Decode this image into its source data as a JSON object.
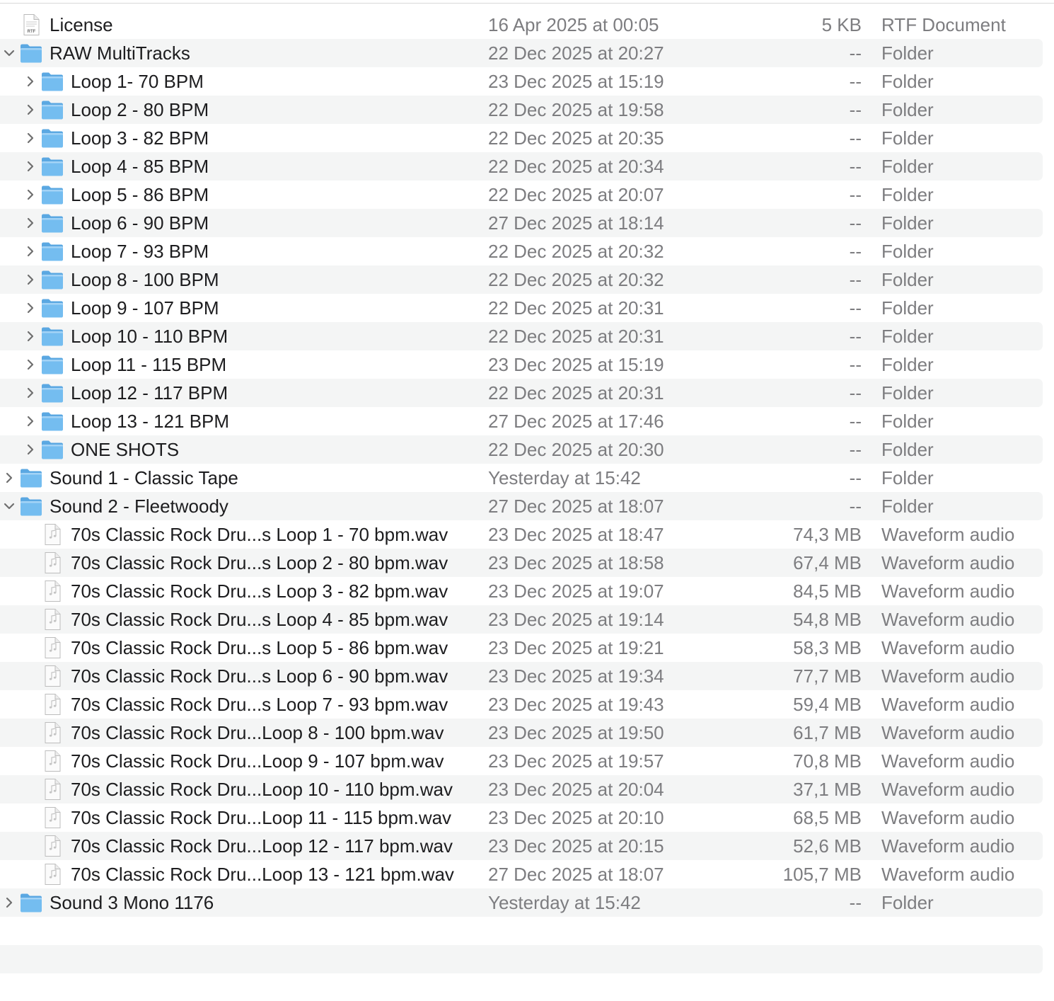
{
  "rows": [
    {
      "name": "License",
      "date": "16 Apr 2025 at 00:05",
      "size": "5 KB",
      "kind": "RTF Document",
      "level": 0,
      "icon": "rtf-document-icon",
      "icon_label": "RTF",
      "disclosure": "none"
    },
    {
      "name": "RAW MultiTracks",
      "date": "22 Dec 2025 at 20:27",
      "size": "--",
      "kind": "Folder",
      "level": 0,
      "icon": "folder-icon",
      "disclosure": "expanded"
    },
    {
      "name": "Loop 1- 70 BPM",
      "date": "23 Dec 2025 at 15:19",
      "size": "--",
      "kind": "Folder",
      "level": 1,
      "icon": "folder-icon",
      "disclosure": "collapsed"
    },
    {
      "name": "Loop 2 - 80 BPM",
      "date": "22 Dec 2025 at 19:58",
      "size": "--",
      "kind": "Folder",
      "level": 1,
      "icon": "folder-icon",
      "disclosure": "collapsed"
    },
    {
      "name": "Loop 3 - 82 BPM",
      "date": "22 Dec 2025 at 20:35",
      "size": "--",
      "kind": "Folder",
      "level": 1,
      "icon": "folder-icon",
      "disclosure": "collapsed"
    },
    {
      "name": "Loop 4 - 85 BPM",
      "date": "22 Dec 2025 at 20:34",
      "size": "--",
      "kind": "Folder",
      "level": 1,
      "icon": "folder-icon",
      "disclosure": "collapsed"
    },
    {
      "name": "Loop 5 - 86 BPM",
      "date": "22 Dec 2025 at 20:07",
      "size": "--",
      "kind": "Folder",
      "level": 1,
      "icon": "folder-icon",
      "disclosure": "collapsed"
    },
    {
      "name": "Loop 6 - 90 BPM",
      "date": "27 Dec 2025 at 18:14",
      "size": "--",
      "kind": "Folder",
      "level": 1,
      "icon": "folder-icon",
      "disclosure": "collapsed"
    },
    {
      "name": "Loop 7 - 93 BPM",
      "date": "22 Dec 2025 at 20:32",
      "size": "--",
      "kind": "Folder",
      "level": 1,
      "icon": "folder-icon",
      "disclosure": "collapsed"
    },
    {
      "name": "Loop 8 - 100 BPM",
      "date": "22 Dec 2025 at 20:32",
      "size": "--",
      "kind": "Folder",
      "level": 1,
      "icon": "folder-icon",
      "disclosure": "collapsed"
    },
    {
      "name": "Loop 9 - 107 BPM",
      "date": "22 Dec 2025 at 20:31",
      "size": "--",
      "kind": "Folder",
      "level": 1,
      "icon": "folder-icon",
      "disclosure": "collapsed"
    },
    {
      "name": "Loop 10 - 110 BPM",
      "date": "22 Dec 2025 at 20:31",
      "size": "--",
      "kind": "Folder",
      "level": 1,
      "icon": "folder-icon",
      "disclosure": "collapsed"
    },
    {
      "name": "Loop 11 - 115 BPM",
      "date": "23 Dec 2025 at 15:19",
      "size": "--",
      "kind": "Folder",
      "level": 1,
      "icon": "folder-icon",
      "disclosure": "collapsed"
    },
    {
      "name": "Loop 12 - 117 BPM",
      "date": "22 Dec 2025 at 20:31",
      "size": "--",
      "kind": "Folder",
      "level": 1,
      "icon": "folder-icon",
      "disclosure": "collapsed"
    },
    {
      "name": "Loop 13 - 121 BPM",
      "date": "27 Dec 2025 at 17:46",
      "size": "--",
      "kind": "Folder",
      "level": 1,
      "icon": "folder-icon",
      "disclosure": "collapsed"
    },
    {
      "name": "ONE SHOTS",
      "date": "22 Dec 2025 at 20:30",
      "size": "--",
      "kind": "Folder",
      "level": 1,
      "icon": "folder-icon",
      "disclosure": "collapsed"
    },
    {
      "name": "Sound 1 - Classic Tape",
      "date": "Yesterday at 15:42",
      "size": "--",
      "kind": "Folder",
      "level": 0,
      "icon": "folder-icon",
      "disclosure": "collapsed"
    },
    {
      "name": "Sound 2 - Fleetwoody",
      "date": "27 Dec 2025 at 18:07",
      "size": "--",
      "kind": "Folder",
      "level": 0,
      "icon": "folder-icon",
      "disclosure": "expanded"
    },
    {
      "name": "70s Classic Rock Dru...s Loop 1 - 70 bpm.wav",
      "date": "23 Dec 2025 at 18:47",
      "size": "74,3 MB",
      "kind": "Waveform audio",
      "level": 1,
      "icon": "audio-file-icon",
      "disclosure": "none"
    },
    {
      "name": "70s Classic Rock Dru...s Loop 2 - 80 bpm.wav",
      "date": "23 Dec 2025 at 18:58",
      "size": "67,4 MB",
      "kind": "Waveform audio",
      "level": 1,
      "icon": "audio-file-icon",
      "disclosure": "none"
    },
    {
      "name": "70s Classic Rock Dru...s Loop 3 - 82 bpm.wav",
      "date": "23 Dec 2025 at 19:07",
      "size": "84,5 MB",
      "kind": "Waveform audio",
      "level": 1,
      "icon": "audio-file-icon",
      "disclosure": "none"
    },
    {
      "name": "70s Classic Rock Dru...s Loop 4 - 85 bpm.wav",
      "date": "23 Dec 2025 at 19:14",
      "size": "54,8 MB",
      "kind": "Waveform audio",
      "level": 1,
      "icon": "audio-file-icon",
      "disclosure": "none"
    },
    {
      "name": "70s Classic Rock Dru...s Loop 5 - 86 bpm.wav",
      "date": "23 Dec 2025 at 19:21",
      "size": "58,3 MB",
      "kind": "Waveform audio",
      "level": 1,
      "icon": "audio-file-icon",
      "disclosure": "none"
    },
    {
      "name": "70s Classic Rock Dru...s Loop 6 - 90 bpm.wav",
      "date": "23 Dec 2025 at 19:34",
      "size": "77,7 MB",
      "kind": "Waveform audio",
      "level": 1,
      "icon": "audio-file-icon",
      "disclosure": "none"
    },
    {
      "name": "70s Classic Rock Dru...s Loop 7 - 93 bpm.wav",
      "date": "23 Dec 2025 at 19:43",
      "size": "59,4 MB",
      "kind": "Waveform audio",
      "level": 1,
      "icon": "audio-file-icon",
      "disclosure": "none"
    },
    {
      "name": "70s Classic Rock Dru...Loop 8 - 100 bpm.wav",
      "date": "23 Dec 2025 at 19:50",
      "size": "61,7 MB",
      "kind": "Waveform audio",
      "level": 1,
      "icon": "audio-file-icon",
      "disclosure": "none"
    },
    {
      "name": "70s Classic Rock Dru...Loop 9 - 107 bpm.wav",
      "date": "23 Dec 2025 at 19:57",
      "size": "70,8 MB",
      "kind": "Waveform audio",
      "level": 1,
      "icon": "audio-file-icon",
      "disclosure": "none"
    },
    {
      "name": "70s Classic Rock Dru...Loop 10 - 110 bpm.wav",
      "date": "23 Dec 2025 at 20:04",
      "size": "37,1 MB",
      "kind": "Waveform audio",
      "level": 1,
      "icon": "audio-file-icon",
      "disclosure": "none"
    },
    {
      "name": "70s Classic Rock Dru...Loop 11 - 115 bpm.wav",
      "date": "23 Dec 2025 at 20:10",
      "size": "68,5 MB",
      "kind": "Waveform audio",
      "level": 1,
      "icon": "audio-file-icon",
      "disclosure": "none"
    },
    {
      "name": "70s Classic Rock Dru...Loop 12 - 117 bpm.wav",
      "date": "23 Dec 2025 at 20:15",
      "size": "52,6 MB",
      "kind": "Waveform audio",
      "level": 1,
      "icon": "audio-file-icon",
      "disclosure": "none"
    },
    {
      "name": "70s Classic Rock Dru...Loop 13 - 121 bpm.wav",
      "date": "27 Dec 2025 at 18:07",
      "size": "105,7 MB",
      "kind": "Waveform audio",
      "level": 1,
      "icon": "audio-file-icon",
      "disclosure": "none"
    },
    {
      "name": "Sound 3 Mono 1176",
      "date": "Yesterday at 15:42",
      "size": "--",
      "kind": "Folder",
      "level": 0,
      "icon": "folder-icon",
      "disclosure": "collapsed"
    }
  ],
  "colors": {
    "stripe": "#f4f5f5",
    "folder_front": "#74bdf0",
    "folder_back": "#5ba8e2",
    "text_primary": "#1d1d1f",
    "text_secondary": "#7d7d80",
    "chevron": "#6f6f6f"
  }
}
